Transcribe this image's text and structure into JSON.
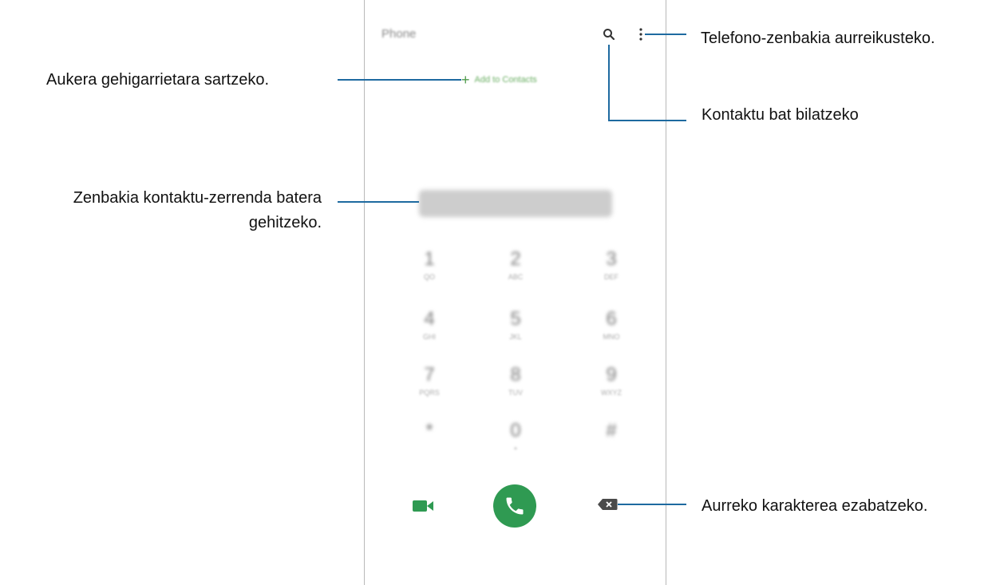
{
  "phone": {
    "app_title": "Phone",
    "add_to_contacts": "Add to Contacts",
    "keypad": [
      {
        "digit": "1",
        "letters": "QO"
      },
      {
        "digit": "2",
        "letters": "ABC"
      },
      {
        "digit": "3",
        "letters": "DEF"
      },
      {
        "digit": "4",
        "letters": "GHI"
      },
      {
        "digit": "5",
        "letters": "JKL"
      },
      {
        "digit": "6",
        "letters": "MNO"
      },
      {
        "digit": "7",
        "letters": "PQRS"
      },
      {
        "digit": "8",
        "letters": "TUV"
      },
      {
        "digit": "9",
        "letters": "WXYZ"
      },
      {
        "digit": "*",
        "letters": ""
      },
      {
        "digit": "0",
        "letters": "+"
      },
      {
        "digit": "#",
        "letters": ""
      }
    ],
    "icons": {
      "search": "search-icon",
      "more": "more-options-icon",
      "video": "video-call-icon",
      "call": "phone-icon",
      "backspace": "backspace-icon"
    },
    "colors": {
      "accent_green": "#2f9a52",
      "callout_line": "#1e6aa0"
    }
  },
  "callouts": {
    "more_options": "Telefono-zenbakia aurreikusteko.",
    "add_option": "Aukera gehigarrietara sartzeko.",
    "search": "Kontaktu bat bilatzeko",
    "add_number_line1": "Zenbakia kontaktu-zerrenda batera",
    "add_number_line2": "gehitzeko.",
    "backspace": "Aurreko karakterea ezabatzeko."
  }
}
